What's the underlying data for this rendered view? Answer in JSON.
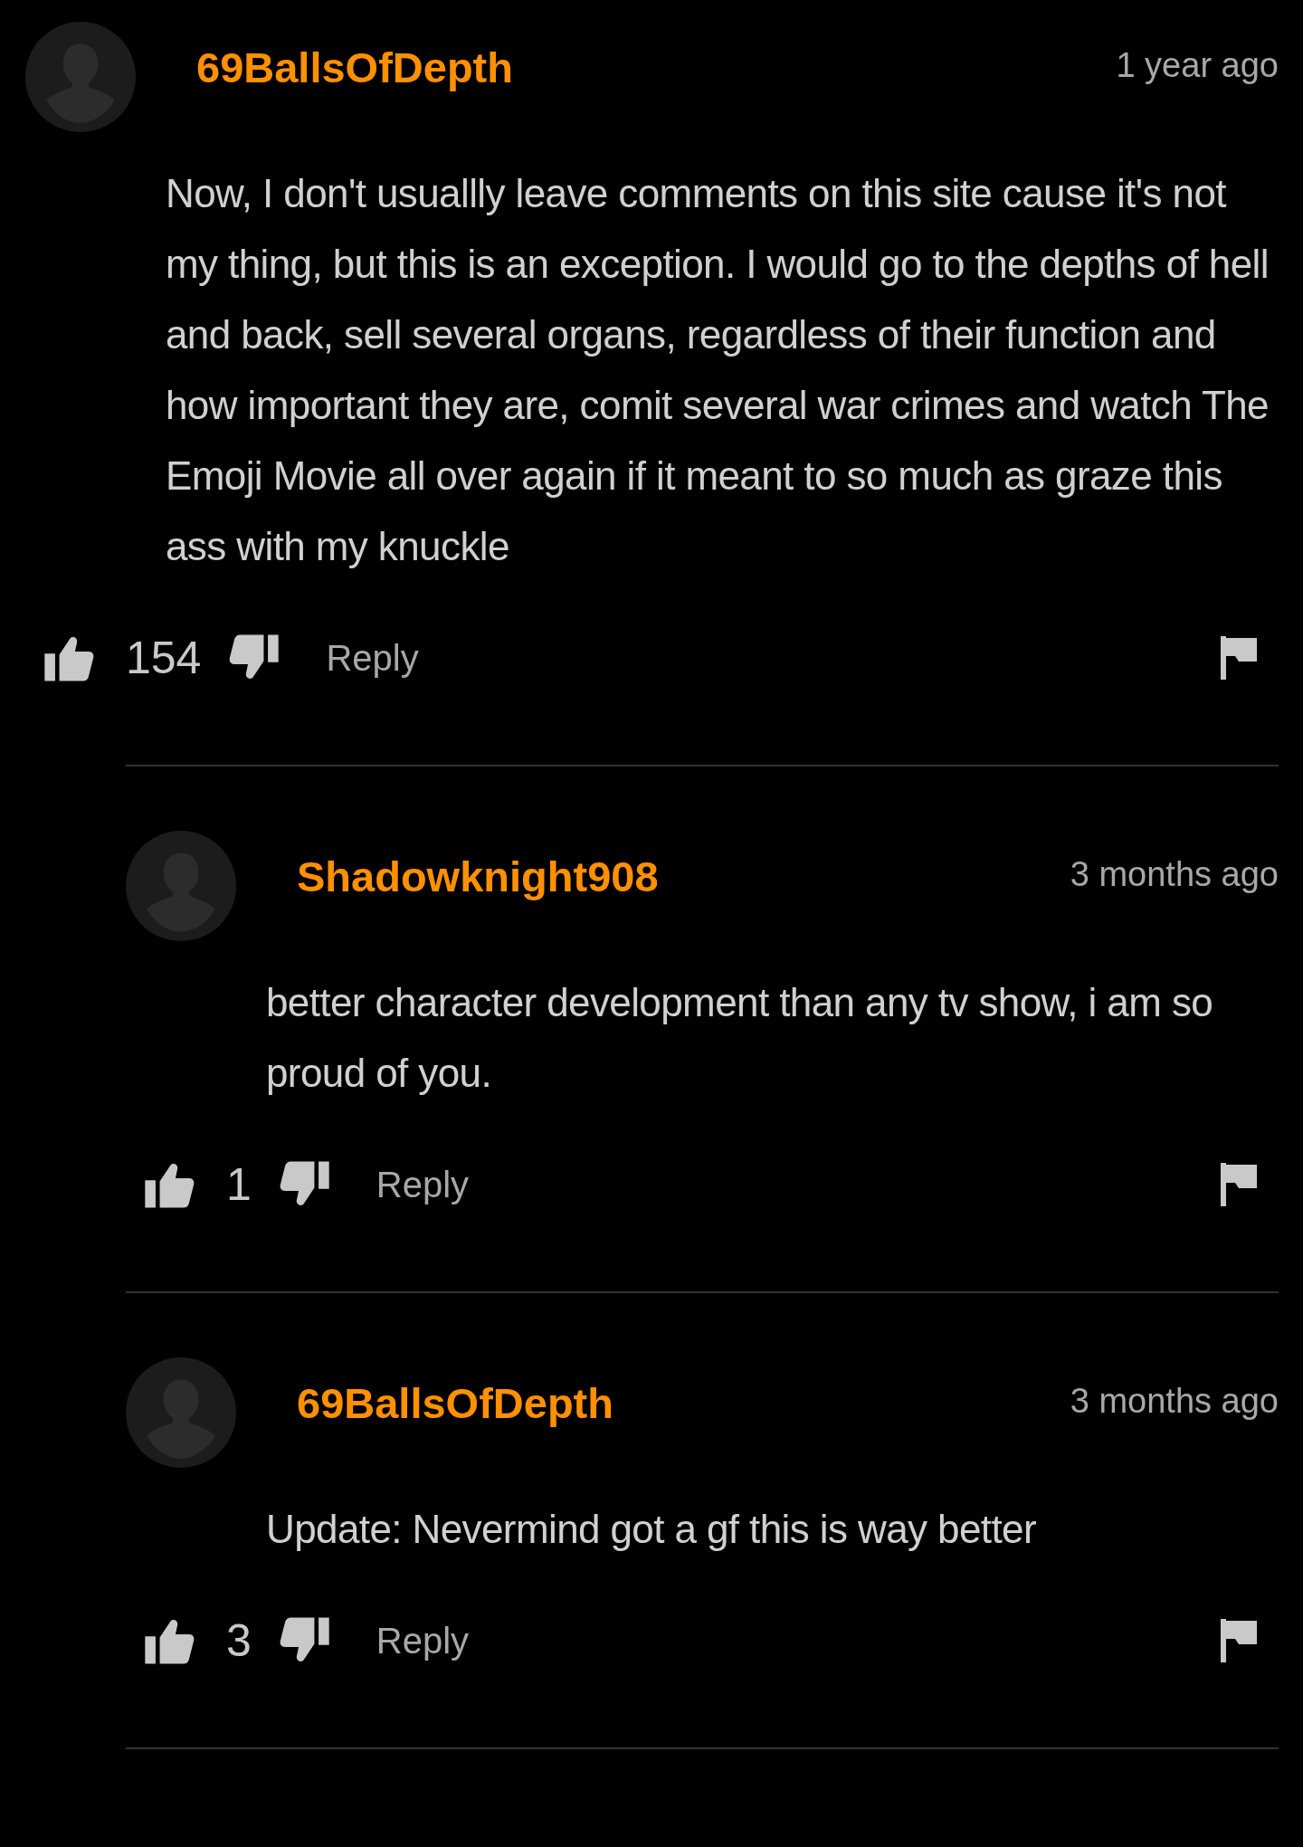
{
  "comments": [
    {
      "username": "69BallsOfDepth",
      "time": "1 year ago",
      "text": "Now, I don't usuallly leave comments on this site cause it's not my thing, but this is an exception. I would go to the depths of hell and back, sell several organs, regardless of their function and how important they are, comit several war crimes and watch The Emoji Movie all over again if it meant to so much as graze this ass with my knuckle",
      "likes": "154",
      "reply_label": "Reply",
      "children": [
        {
          "username": "Shadowknight908",
          "time": "3 months ago",
          "text": "better character development than any tv show, i am so proud of you.",
          "likes": "1",
          "reply_label": "Reply"
        },
        {
          "username": "69BallsOfDepth",
          "time": "3 months ago",
          "text": "Update: Nevermind got a gf this is way better",
          "likes": "3",
          "reply_label": "Reply"
        }
      ]
    }
  ]
}
